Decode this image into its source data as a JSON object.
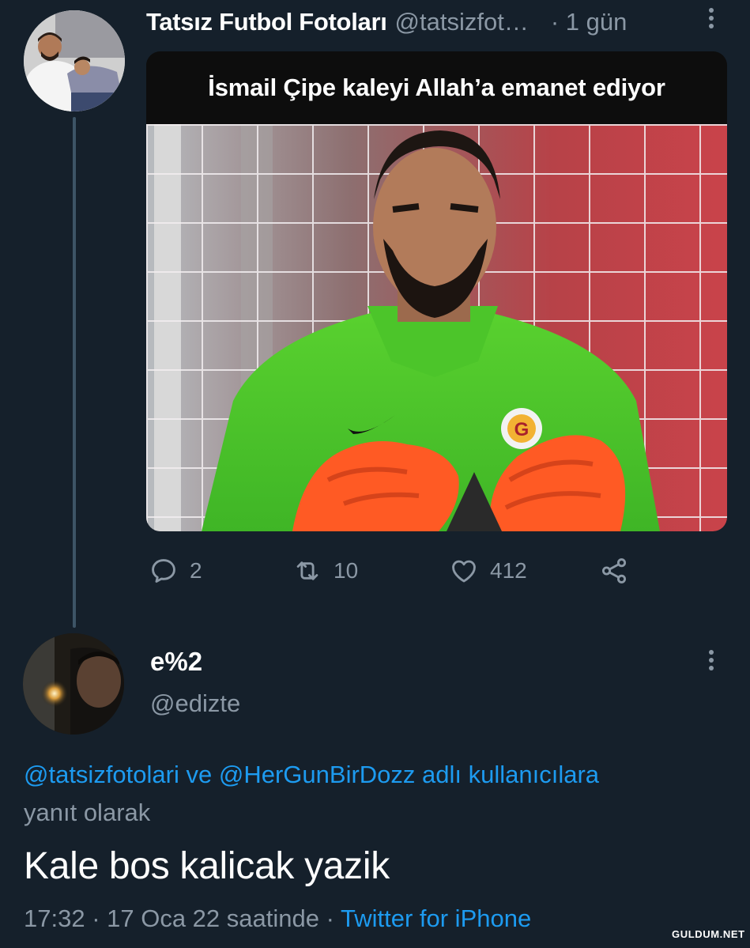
{
  "tweet": {
    "author_name": "Tatsız Futbol Fotoları",
    "author_handle": "@tatsizfot…",
    "time": "· 1 gün",
    "image_caption": "İsmail Çipe kaleyi Allah’a emanet ediyor",
    "replies": "2",
    "retweets": "10",
    "likes": "412"
  },
  "reply": {
    "author_name": "e%2",
    "author_handle": "@edizte",
    "reply_to_mention_1": "@tatsizfotolari",
    "reply_to_connector": "ve",
    "reply_to_mention_2": "@HerGunBirDozz",
    "reply_to_suffix": "adlı kullanıcılara",
    "reply_to_line2": "yanıt olarak",
    "text": "Kale bos kalicak yazik",
    "timestamp": "17:32 · 17 Oca 22 saatinde ·",
    "source": "Twitter for iPhone"
  },
  "watermark": "GULDUM.NET",
  "icons": {
    "reply": "reply-icon",
    "retweet": "retweet-icon",
    "like": "heart-icon",
    "share": "share-icon",
    "more": "more-vertical-icon"
  },
  "colors": {
    "background": "#15202b",
    "secondary_text": "#8b98a5",
    "link": "#1d9bf0",
    "thread_line": "#3d5466"
  }
}
